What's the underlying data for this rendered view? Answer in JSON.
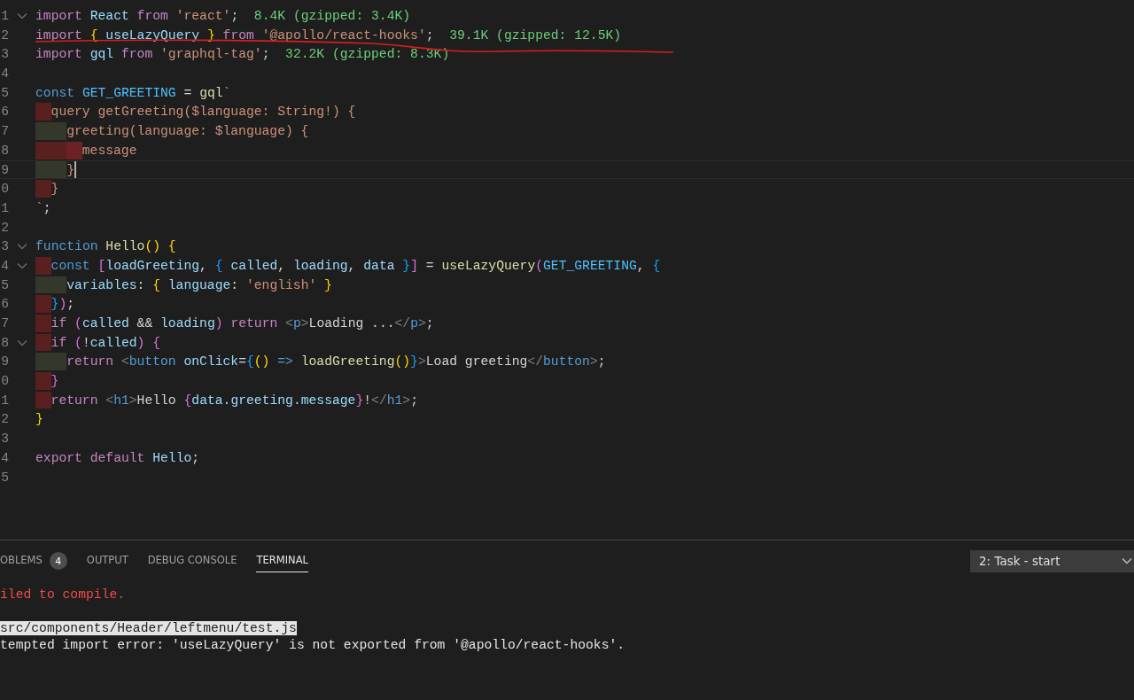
{
  "editor": {
    "lines": [
      {
        "number": "1",
        "fold": true,
        "current": false,
        "tokens": [
          {
            "text": "import",
            "kind": "kw"
          },
          {
            "text": " React ",
            "kind": "var"
          },
          {
            "text": "from",
            "kind": "kw"
          },
          {
            "text": " 'react'",
            "kind": "str"
          },
          {
            "text": ";",
            "kind": "punc"
          },
          {
            "text": "  8.4K (gzipped: 3.4K)",
            "kind": "size"
          }
        ]
      },
      {
        "number": "2",
        "fold": false,
        "current": false,
        "tokens": [
          {
            "text": "import",
            "kind": "kw"
          },
          {
            "text": " {",
            "kind": "y"
          },
          {
            "text": " useLazyQuery ",
            "kind": "var"
          },
          {
            "text": "}",
            "kind": "y"
          },
          {
            "text": " from",
            "kind": "kw"
          },
          {
            "text": " '@apollo/react-hooks'",
            "kind": "str"
          },
          {
            "text": ";",
            "kind": "punc"
          },
          {
            "text": "  39.1K (gzipped: 12.5K)",
            "kind": "size"
          }
        ]
      },
      {
        "number": "3",
        "fold": false,
        "current": false,
        "tokens": [
          {
            "text": "import",
            "kind": "kw"
          },
          {
            "text": " gql ",
            "kind": "var"
          },
          {
            "text": "from",
            "kind": "kw"
          },
          {
            "text": " 'graphql-tag'",
            "kind": "str"
          },
          {
            "text": ";",
            "kind": "punc"
          },
          {
            "text": "  32.2K (gzipped: 8.3K)",
            "kind": "size"
          }
        ]
      },
      {
        "number": "4",
        "fold": false,
        "current": false
      },
      {
        "number": "5",
        "fold": false,
        "current": false,
        "tokens": [
          {
            "text": "const",
            "kind": "decl"
          },
          {
            "text": " GET_GREETING",
            "kind": "const"
          },
          {
            "text": " = ",
            "kind": "punc"
          },
          {
            "text": "gql",
            "kind": "func"
          },
          {
            "text": "`",
            "kind": "str"
          }
        ]
      },
      {
        "number": "6",
        "fold": false,
        "current": false,
        "guides": [
          {
            "color": "#5a1f1f"
          }
        ],
        "tokens": [
          {
            "text": "query getGreeting($language: String!) {",
            "kind": "str"
          }
        ]
      },
      {
        "number": "7",
        "fold": false,
        "current": false,
        "guides": [
          {
            "color": "#33382a"
          },
          {
            "color": "#33382a"
          }
        ],
        "tokens": [
          {
            "text": "greeting(language: $language) {",
            "kind": "str"
          }
        ]
      },
      {
        "number": "8",
        "fold": false,
        "current": false,
        "guides": [
          {
            "color": "#5a1f1f"
          },
          {
            "color": "#5a1f1f"
          },
          {
            "color": "#6a2222"
          }
        ],
        "tokens": [
          {
            "text": "message",
            "kind": "str"
          }
        ]
      },
      {
        "number": "9",
        "fold": false,
        "current": true,
        "guides": [
          {
            "color": "#33382a"
          },
          {
            "color": "#33382a"
          }
        ],
        "tokens": [
          {
            "text": "}",
            "kind": "str"
          }
        ]
      },
      {
        "number": "0",
        "fold": false,
        "current": false,
        "guides": [
          {
            "color": "#5a1f1f"
          }
        ],
        "tokens": [
          {
            "text": "}",
            "kind": "str"
          }
        ]
      },
      {
        "number": "1",
        "fold": false,
        "current": false,
        "tokens": [
          {
            "text": "`",
            "kind": "str"
          },
          {
            "text": ";",
            "kind": "punc"
          }
        ]
      },
      {
        "number": "2",
        "fold": false,
        "current": false
      },
      {
        "number": "3",
        "fold": true,
        "current": false,
        "tokens": [
          {
            "text": "function",
            "kind": "decl"
          },
          {
            "text": " Hello",
            "kind": "func"
          },
          {
            "text": "() {",
            "kind": "y"
          }
        ]
      },
      {
        "number": "4",
        "fold": true,
        "current": false,
        "guides": [
          {
            "color": "#5a1f1f"
          }
        ],
        "tokens": [
          {
            "text": "const ",
            "kind": "decl"
          },
          {
            "text": "[",
            "kind": "p"
          },
          {
            "text": "loadGreeting",
            "kind": "var"
          },
          {
            "text": ", ",
            "kind": "punc"
          },
          {
            "text": "{",
            "kind": "b"
          },
          {
            "text": " called",
            "kind": "var"
          },
          {
            "text": ", ",
            "kind": "punc"
          },
          {
            "text": "loading",
            "kind": "var"
          },
          {
            "text": ", ",
            "kind": "punc"
          },
          {
            "text": "data ",
            "kind": "var"
          },
          {
            "text": "}",
            "kind": "b"
          },
          {
            "text": "]",
            "kind": "p"
          },
          {
            "text": " = ",
            "kind": "punc"
          },
          {
            "text": "useLazyQuery",
            "kind": "func"
          },
          {
            "text": "(",
            "kind": "p"
          },
          {
            "text": "GET_GREETING",
            "kind": "const"
          },
          {
            "text": ", ",
            "kind": "punc"
          },
          {
            "text": "{",
            "kind": "b"
          }
        ]
      },
      {
        "number": "5",
        "fold": false,
        "current": false,
        "guides": [
          {
            "color": "#33382a"
          },
          {
            "color": "#33382a"
          }
        ],
        "tokens": [
          {
            "text": "variables",
            "kind": "var"
          },
          {
            "text": ": ",
            "kind": "punc"
          },
          {
            "text": "{",
            "kind": "y"
          },
          {
            "text": " language",
            "kind": "var"
          },
          {
            "text": ": ",
            "kind": "punc"
          },
          {
            "text": "'english'",
            "kind": "str"
          },
          {
            "text": " }",
            "kind": "y"
          }
        ]
      },
      {
        "number": "6",
        "fold": false,
        "current": false,
        "guides": [
          {
            "color": "#5a1f1f"
          }
        ],
        "tokens": [
          {
            "text": "}",
            "kind": "b"
          },
          {
            "text": ")",
            "kind": "p"
          },
          {
            "text": ";",
            "kind": "punc"
          }
        ]
      },
      {
        "number": "7",
        "fold": false,
        "current": false,
        "guides": [
          {
            "color": "#5a1f1f"
          }
        ],
        "tokens": [
          {
            "text": "if",
            "kind": "kw"
          },
          {
            "text": " (",
            "kind": "p"
          },
          {
            "text": "called",
            "kind": "var"
          },
          {
            "text": " && ",
            "kind": "punc"
          },
          {
            "text": "loading",
            "kind": "var"
          },
          {
            "text": ")",
            "kind": "p"
          },
          {
            "text": " return ",
            "kind": "kw"
          },
          {
            "text": "<",
            "kind": "tag"
          },
          {
            "text": "p",
            "kind": "decl"
          },
          {
            "text": ">",
            "kind": "tag"
          },
          {
            "text": "Loading ...",
            "kind": "punc"
          },
          {
            "text": "</",
            "kind": "tag"
          },
          {
            "text": "p",
            "kind": "decl"
          },
          {
            "text": ">",
            "kind": "tag"
          },
          {
            "text": ";",
            "kind": "punc"
          }
        ]
      },
      {
        "number": "8",
        "fold": true,
        "current": false,
        "guides": [
          {
            "color": "#5a1f1f"
          }
        ],
        "tokens": [
          {
            "text": "if",
            "kind": "kw"
          },
          {
            "text": " (",
            "kind": "p"
          },
          {
            "text": "!",
            "kind": "punc"
          },
          {
            "text": "called",
            "kind": "var"
          },
          {
            "text": ")",
            "kind": "p"
          },
          {
            "text": " {",
            "kind": "p"
          }
        ]
      },
      {
        "number": "9",
        "fold": false,
        "current": false,
        "guides": [
          {
            "color": "#33382a"
          },
          {
            "color": "#33382a"
          }
        ],
        "tokens": [
          {
            "text": "return ",
            "kind": "kw"
          },
          {
            "text": "<",
            "kind": "tag"
          },
          {
            "text": "button",
            "kind": "decl"
          },
          {
            "text": " onClick",
            "kind": "var"
          },
          {
            "text": "=",
            "kind": "punc"
          },
          {
            "text": "{",
            "kind": "b"
          },
          {
            "text": "()",
            "kind": "y"
          },
          {
            "text": " => ",
            "kind": "decl"
          },
          {
            "text": "loadGreeting",
            "kind": "func"
          },
          {
            "text": "()",
            "kind": "y"
          },
          {
            "text": "}",
            "kind": "b"
          },
          {
            "text": ">",
            "kind": "tag"
          },
          {
            "text": "Load greeting",
            "kind": "punc"
          },
          {
            "text": "</",
            "kind": "tag"
          },
          {
            "text": "button",
            "kind": "decl"
          },
          {
            "text": ">",
            "kind": "tag"
          },
          {
            "text": ";",
            "kind": "punc"
          }
        ]
      },
      {
        "number": "0",
        "fold": false,
        "current": false,
        "guides": [
          {
            "color": "#5a1f1f"
          }
        ],
        "tokens": [
          {
            "text": "}",
            "kind": "p"
          }
        ]
      },
      {
        "number": "1",
        "fold": false,
        "current": false,
        "guides": [
          {
            "color": "#5a1f1f"
          }
        ],
        "tokens": [
          {
            "text": "return ",
            "kind": "kw"
          },
          {
            "text": "<",
            "kind": "tag"
          },
          {
            "text": "h1",
            "kind": "decl"
          },
          {
            "text": ">",
            "kind": "tag"
          },
          {
            "text": "Hello ",
            "kind": "punc"
          },
          {
            "text": "{",
            "kind": "p"
          },
          {
            "text": "data.greeting.message",
            "kind": "var"
          },
          {
            "text": "}",
            "kind": "p"
          },
          {
            "text": "!",
            "kind": "punc"
          },
          {
            "text": "</",
            "kind": "tag"
          },
          {
            "text": "h1",
            "kind": "decl"
          },
          {
            "text": ">",
            "kind": "tag"
          },
          {
            "text": ";",
            "kind": "punc"
          }
        ]
      },
      {
        "number": "2",
        "fold": false,
        "current": false,
        "tokens": [
          {
            "text": "}",
            "kind": "y"
          }
        ]
      },
      {
        "number": "3",
        "fold": false,
        "current": false
      },
      {
        "number": "4",
        "fold": false,
        "current": false,
        "tokens": [
          {
            "text": "export default ",
            "kind": "kw"
          },
          {
            "text": "Hello",
            "kind": "var"
          },
          {
            "text": ";",
            "kind": "punc"
          }
        ]
      },
      {
        "number": "5",
        "fold": false,
        "current": false
      }
    ]
  },
  "panel": {
    "tabs": [
      {
        "label": "OBLEMS",
        "badge": "4",
        "selected": false
      },
      {
        "label": "OUTPUT",
        "selected": false
      },
      {
        "label": "DEBUG CONSOLE",
        "selected": false
      },
      {
        "label": "TERMINAL",
        "selected": true
      }
    ],
    "task_select": {
      "value": "2: Task - start"
    },
    "terminal_lines": [
      {
        "text": "iled to compile.",
        "kind": "error"
      },
      {
        "kind": "blank"
      },
      {
        "text": "src/components/Header/leftmenu/test.js",
        "kind": "highlight"
      },
      {
        "text": "tempted import error: 'useLazyQuery' is not exported from '@apollo/react-hooks'.",
        "kind": "plain"
      }
    ]
  }
}
